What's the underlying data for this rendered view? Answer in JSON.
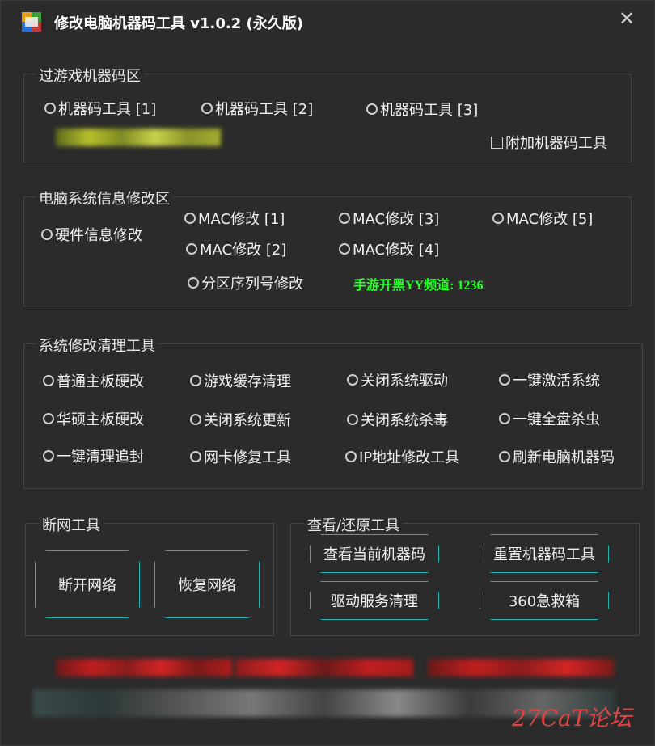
{
  "title": "修改电脑机器码工具 v1.0.2 (永久版)",
  "close_glyph": "✕",
  "section1": {
    "legend": "过游戏机器码区",
    "radios": [
      "机器码工具 [1]",
      "机器码工具 [2]",
      "机器码工具 [3]"
    ],
    "checkbox": "附加机器码工具"
  },
  "section2": {
    "legend": "电脑系统信息修改区",
    "hardware": "硬件信息修改",
    "mac": [
      "MAC修改 [1]",
      "MAC修改 [3]",
      "MAC修改 [5]",
      "MAC修改 [2]",
      "MAC修改 [4]"
    ],
    "partition": "分区序列号修改",
    "channel": "手游开黑YY频道: 1236"
  },
  "section3": {
    "legend": "系统修改清理工具",
    "items": [
      "普通主板硬改",
      "游戏缓存清理",
      "关闭系统驱动",
      "一键激活系统",
      "华硕主板硬改",
      "关闭系统更新",
      "关闭系统杀毒",
      "一键全盘杀虫",
      "一键清理追封",
      "网卡修复工具",
      "IP地址修改工具",
      "刷新电脑机器码"
    ]
  },
  "network": {
    "legend": "断网工具",
    "disconnect": "断开网络",
    "restore": "恢复网络"
  },
  "view": {
    "legend": "查看/还原工具",
    "view_code": "查看当前机器码",
    "reset_tool": "重置机器码工具",
    "driver_clean": "驱动服务清理",
    "emergency": "360急救箱"
  },
  "watermark": "27CaT论坛"
}
